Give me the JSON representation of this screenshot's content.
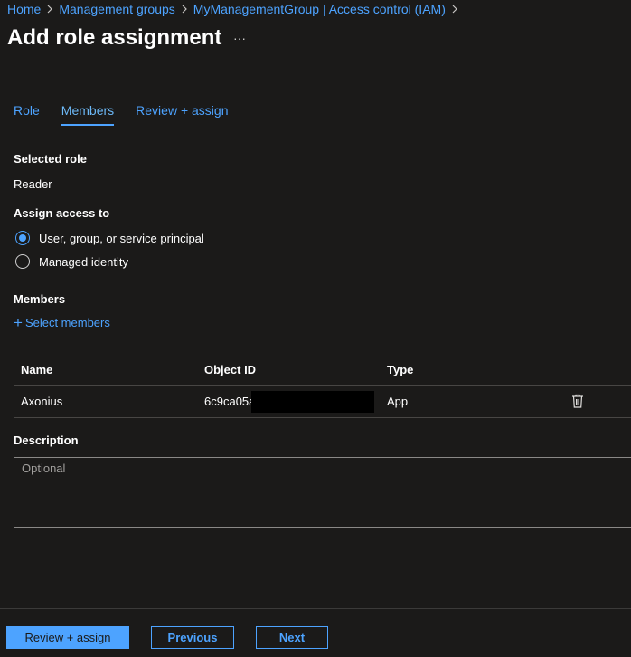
{
  "breadcrumb": {
    "items": [
      "Home",
      "Management groups",
      "MyManagementGroup | Access control (IAM)"
    ]
  },
  "page": {
    "title": "Add role assignment",
    "more_label": "···"
  },
  "tabs": [
    {
      "label": "Role",
      "active": false
    },
    {
      "label": "Members",
      "active": true
    },
    {
      "label": "Review + assign",
      "active": false
    }
  ],
  "selected_role": {
    "label": "Selected role",
    "value": "Reader"
  },
  "assign_access": {
    "label": "Assign access to",
    "options": [
      {
        "label": "User, group, or service principal",
        "checked": true
      },
      {
        "label": "Managed identity",
        "checked": false
      }
    ]
  },
  "members": {
    "label": "Members",
    "select_label": "Select members",
    "columns": [
      "Name",
      "Object ID",
      "Type"
    ],
    "rows": [
      {
        "name": "Axonius",
        "object_id": "6c9ca05a",
        "type": "App"
      }
    ]
  },
  "description": {
    "label": "Description",
    "placeholder": "Optional",
    "value": ""
  },
  "footer": {
    "review_assign_label": "Review + assign",
    "previous_label": "Previous",
    "next_label": "Next"
  },
  "icons": {
    "breadcrumb_separator": "chevron-right-icon",
    "delete": "trash-icon",
    "add": "plus-icon"
  },
  "colors": {
    "background": "#1b1a19",
    "accent": "#4da3ff",
    "text": "#ffffff",
    "border": "#484644"
  }
}
